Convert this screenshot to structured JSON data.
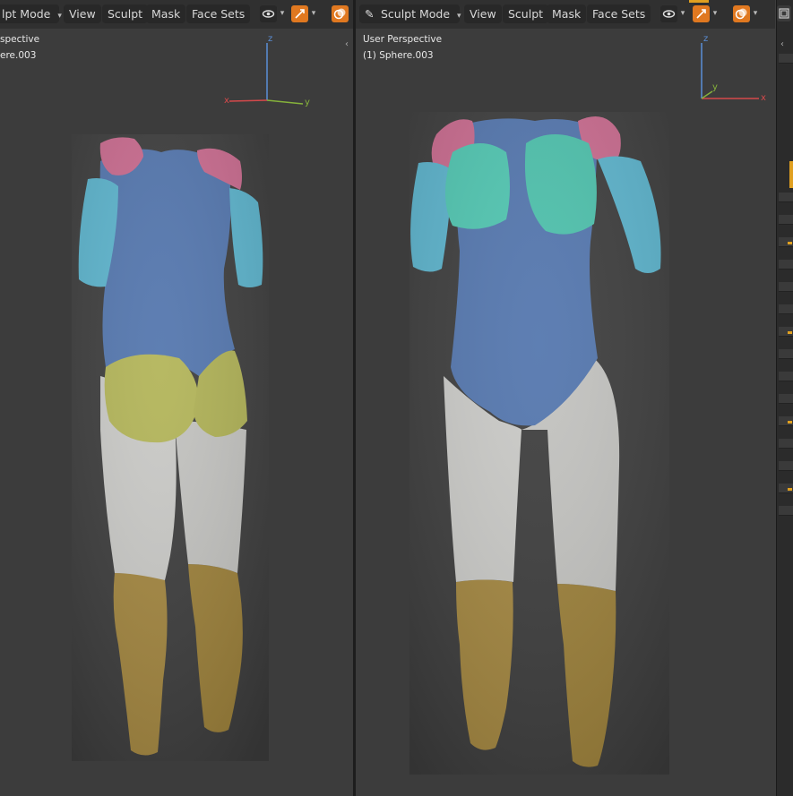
{
  "left_viewport": {
    "mode_label": "lpt Mode",
    "menu": [
      "View",
      "Sculpt",
      "Mask",
      "Face Sets"
    ],
    "overlay_title": "spective",
    "overlay_object": "ere.003",
    "gizmo": {
      "x": "x",
      "y": "y",
      "z": "z"
    }
  },
  "right_viewport": {
    "mode_label": "Sculpt Mode",
    "menu": [
      "View",
      "Sculpt",
      "Mask",
      "Face Sets"
    ],
    "overlay_title": "User Perspective",
    "overlay_object": "(1) Sphere.003",
    "gizmo": {
      "x": "x",
      "y": "y",
      "z": "z"
    }
  },
  "icons": {
    "mode_icon": "brush-icon",
    "visibility": "eye-icon",
    "gizmo_toggle": "gizmo-icon",
    "overlay_toggle": "overlay-icon",
    "chevron": "▾",
    "collapse": "‹"
  },
  "colors": {
    "face_set_shoulders": "#c96a8e",
    "face_set_arms": "#5bb3cc",
    "face_set_torso": "#5275ad",
    "face_set_chest": "#4fc5b0",
    "face_set_glutes": "#b2b457",
    "face_set_thighs": "#c9c9c6",
    "face_set_calves": "#a3863f",
    "accent": "#e07820",
    "axis_x": "#d5494b",
    "axis_y": "#86b23b",
    "axis_z": "#5a8ed6"
  }
}
